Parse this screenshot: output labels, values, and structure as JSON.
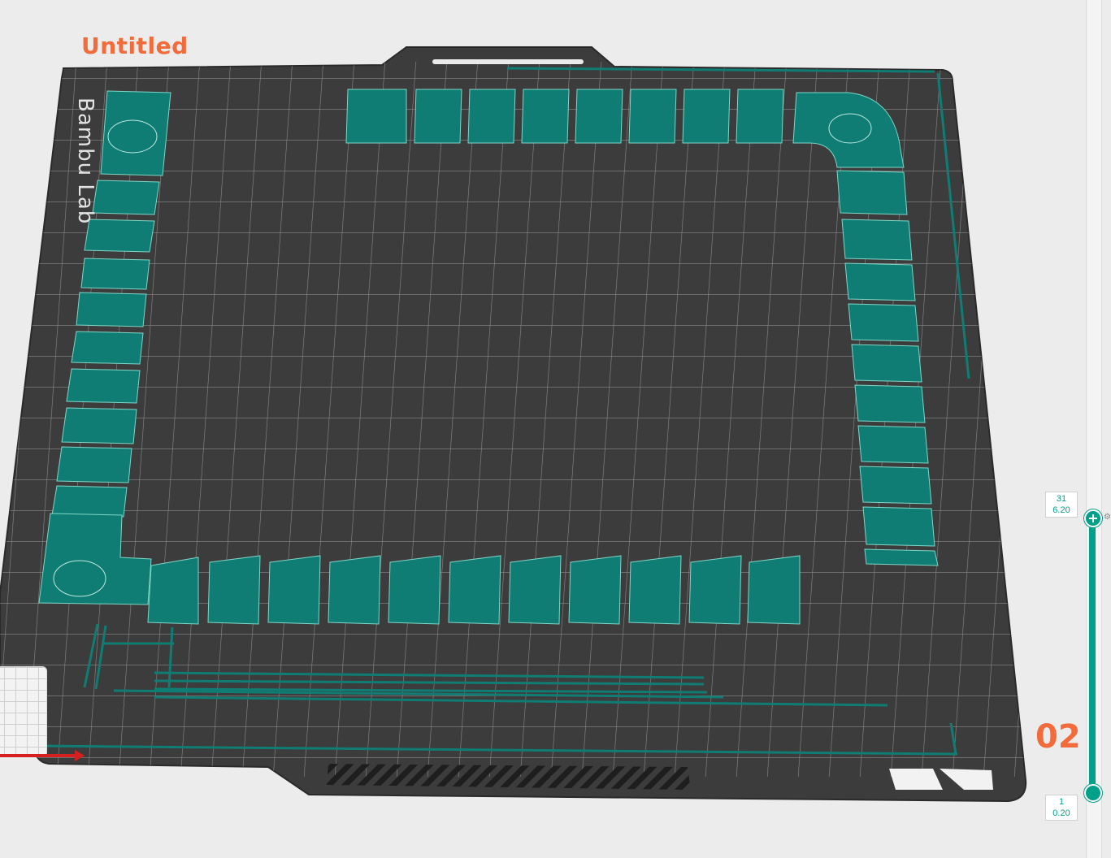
{
  "project": {
    "name": "Untitled"
  },
  "plate": {
    "brand": "Bambu Lab",
    "number": "02"
  },
  "layer_slider": {
    "top": {
      "layer": "31",
      "height": "6.20"
    },
    "bottom": {
      "layer": "1",
      "height": "0.20"
    }
  },
  "colors": {
    "accent": "#f26b3a",
    "filament": "#0f7d74",
    "plate": "#3d3d3d",
    "grid": "#7a7a7a",
    "slider": "#00a08a"
  },
  "icons": [
    "axis-x-icon",
    "gear-icon",
    "slider-handle-icon"
  ]
}
